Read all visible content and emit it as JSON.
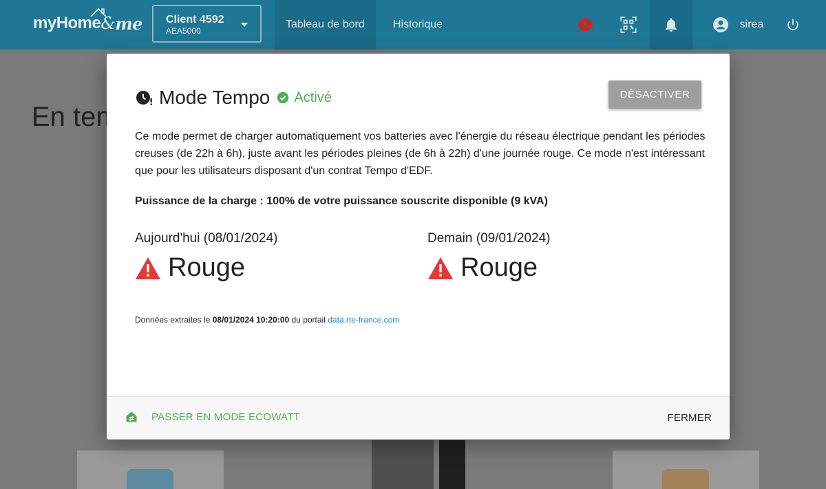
{
  "app": {
    "logo_text_my": "my",
    "logo_text_home": "Home",
    "logo_text_amp": "&",
    "logo_text_me": "me"
  },
  "client_select": {
    "name": "Client 4592",
    "id": "AEA5000"
  },
  "nav": {
    "dashboard": "Tableau de bord",
    "history": "Historique"
  },
  "user": {
    "name": "sirea"
  },
  "page": {
    "title": "En temps réel"
  },
  "modal": {
    "title": "Mode Tempo",
    "status": "Activé",
    "deactivate_label": "DÉSACTIVER",
    "description": "Ce mode permet de charger automatiquement vos batteries avec l'énergie du réseau électrique pendant les périodes creuses (de 22h à 6h), juste avant les périodes pleines (de 6h à 22h) d'une journée rouge. Ce mode n'est intéressant que pour les utilisateurs disposant d'un contrat Tempo d'EDF.",
    "charge_power": "Puissance de la charge : 100% de votre puissance souscrite disponible (9 kVA)",
    "today": {
      "label": "Aujourd'hui (08/01/2024)",
      "color": "Rouge"
    },
    "tomorrow": {
      "label": "Demain (09/01/2024)",
      "color": "Rouge"
    },
    "source_prefix": "Données extraites le ",
    "source_datetime": "08/01/2024 10:20:00",
    "source_middle": " du portail ",
    "source_link": "data.rte-france.com",
    "ecowatt_label": "PASSER EN MODE ECOWATT",
    "close_label": "FERMER"
  },
  "colors": {
    "topbar": "#1f7796",
    "active_green": "#4caf50",
    "alert_red": "#e53935",
    "link_blue": "#1e88e5",
    "button_grey": "#9e9e9e"
  },
  "icons": {
    "clock_alert": "clock-alert-icon",
    "qr": "qr-code-icon",
    "bell": "bell-icon",
    "account": "account-circle-icon",
    "power": "power-icon",
    "check": "check-circle-icon",
    "warning": "warning-icon",
    "ecowatt": "house-swap-icon"
  }
}
